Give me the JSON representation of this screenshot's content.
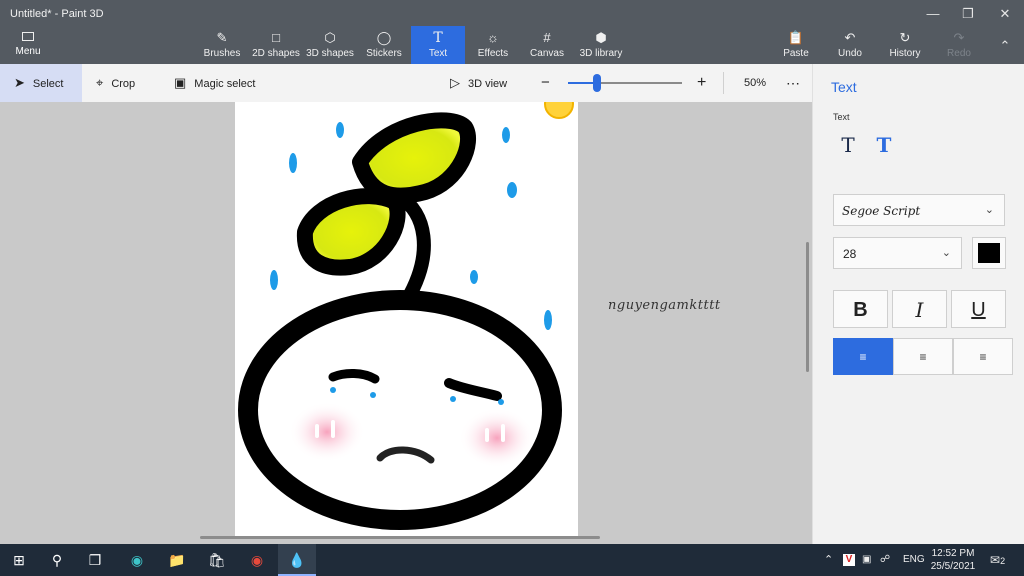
{
  "window": {
    "title": "Untitled* - Paint 3D"
  },
  "ribbon": {
    "menu_label": "Menu",
    "tools": [
      {
        "label": "Brushes",
        "icon": "brush-icon"
      },
      {
        "label": "2D shapes",
        "icon": "shapes-2d-icon"
      },
      {
        "label": "3D shapes",
        "icon": "cube-icon"
      },
      {
        "label": "Stickers",
        "icon": "sticker-icon"
      },
      {
        "label": "Text",
        "icon": "text-icon"
      },
      {
        "label": "Effects",
        "icon": "sun-icon"
      },
      {
        "label": "Canvas",
        "icon": "canvas-icon"
      },
      {
        "label": "3D library",
        "icon": "library-icon"
      }
    ],
    "actions": {
      "paste": "Paste",
      "undo": "Undo",
      "history": "History",
      "redo": "Redo"
    }
  },
  "subtoolbar": {
    "select": "Select",
    "crop": "Crop",
    "magic_select": "Magic select",
    "view_3d": "3D view",
    "zoom_value": 0.25,
    "zoom_label": "50%"
  },
  "canvas": {
    "signature_text": "nguyengamktttt"
  },
  "panel": {
    "title": "Text",
    "subtitle": "Text",
    "font": "Segoe Script",
    "size": "28",
    "text_color": "#000000",
    "bold": "B",
    "italic": "I",
    "underline": "U",
    "alignment_selected": "left"
  },
  "taskbar": {
    "lang": "ENG",
    "time": "12:52 PM",
    "date": "25/5/2021",
    "notifications": "2"
  },
  "colors": {
    "accent": "#2d6cdf",
    "titlebar": "#545a61",
    "taskbar": "#1f2b39"
  }
}
